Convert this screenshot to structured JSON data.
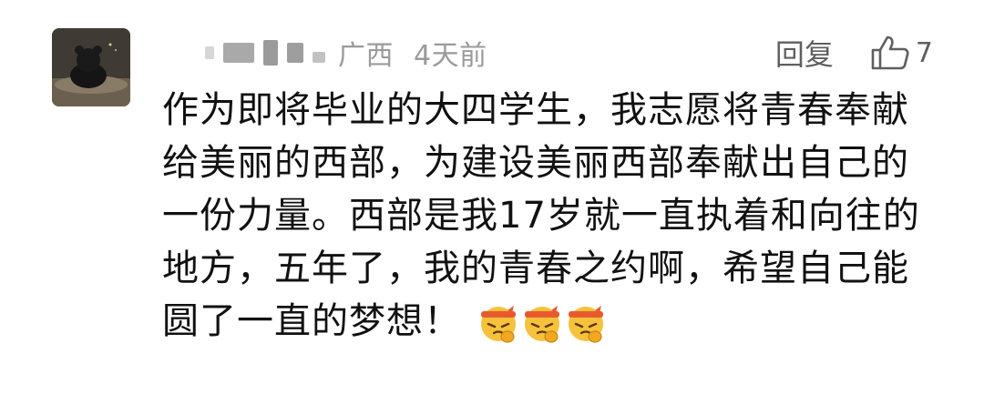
{
  "comment": {
    "location": "广西",
    "time": "4天前",
    "reply_label": "回复",
    "like_count": "7",
    "lines": [
      "作为即将毕业的大四学生，我志愿将青春奉献",
      "给美丽的西部，为建设美丽西部奉献出自己的",
      "一份力量。西部是我17岁就一直执着和向往的",
      "地方，五年了，我的青春之约啊，希望自己能",
      "圆了一直的梦想！"
    ],
    "emojis": [
      "fighting-emoji",
      "fighting-emoji",
      "fighting-emoji"
    ]
  },
  "colors": {
    "meta_text": "#9a9a9a",
    "action_text": "#5f5f5f",
    "body_text": "#111111",
    "emoji_face": "#f7c23b",
    "emoji_band": "#e85a2e"
  }
}
